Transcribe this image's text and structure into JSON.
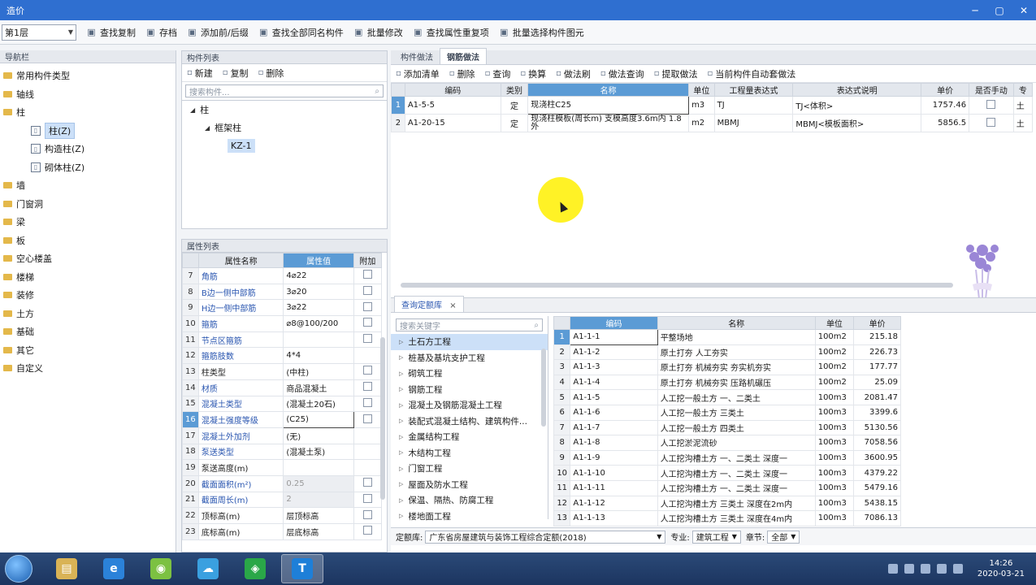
{
  "window": {
    "title": "造价",
    "controls": [
      "─",
      "▢",
      "✕"
    ]
  },
  "toolbar": {
    "floor_value": "第1层",
    "buttons": [
      {
        "label": "查找复制",
        "icon": "copy-icon"
      },
      {
        "label": "存档",
        "icon": "save-icon"
      },
      {
        "label": "添加前/后缀",
        "icon": "prefix-icon"
      },
      {
        "label": "查找全部同名构件",
        "icon": "find-icon"
      },
      {
        "label": "批量修改",
        "icon": "batch-edit-icon"
      },
      {
        "label": "查找属性重复项",
        "icon": "search-icon"
      },
      {
        "label": "批量选择构件图元",
        "icon": "select-icon"
      }
    ]
  },
  "nav": {
    "header": "导航栏",
    "items": [
      {
        "label": "常用构件类型",
        "child": false
      },
      {
        "label": "轴线",
        "child": false
      },
      {
        "label": "柱",
        "child": false
      },
      {
        "label": "柱(Z)",
        "child": true,
        "selected": true,
        "icon": "column-icon"
      },
      {
        "label": "构造柱(Z)",
        "child": true,
        "icon": "constructional-column-icon"
      },
      {
        "label": "砌体柱(Z)",
        "child": true,
        "icon": "masonry-column-icon"
      },
      {
        "label": "墙",
        "child": false
      },
      {
        "label": "门窗洞",
        "child": false
      },
      {
        "label": "梁",
        "child": false
      },
      {
        "label": "板",
        "child": false
      },
      {
        "label": "空心楼盖",
        "child": false
      },
      {
        "label": "楼梯",
        "child": false
      },
      {
        "label": "装修",
        "child": false
      },
      {
        "label": "土方",
        "child": false
      },
      {
        "label": "基础",
        "child": false
      },
      {
        "label": "其它",
        "child": false
      },
      {
        "label": "自定义",
        "child": false
      }
    ]
  },
  "component_list": {
    "header": "构件列表",
    "buttons": [
      {
        "label": "新建",
        "icon": "new-icon"
      },
      {
        "label": "复制",
        "icon": "copy-icon"
      },
      {
        "label": "删除",
        "icon": "delete-icon"
      }
    ],
    "search_placeholder": "搜索构件...",
    "tree": {
      "root": "柱",
      "group": "框架柱",
      "leaf": "KZ-1"
    }
  },
  "properties": {
    "header": "属性列表",
    "columns": [
      "属性名称",
      "属性值",
      "附加"
    ],
    "rows": [
      {
        "no": "7",
        "name": "角筋",
        "value": "4⌀22",
        "check": true
      },
      {
        "no": "8",
        "name": "B边一侧中部筋",
        "value": "3⌀20",
        "check": true
      },
      {
        "no": "9",
        "name": "H边一侧中部筋",
        "value": "3⌀22",
        "check": true
      },
      {
        "no": "10",
        "name": "箍筋",
        "value": "⌀8@100/200",
        "check": true
      },
      {
        "no": "11",
        "name": "节点区箍筋",
        "value": "",
        "check": true
      },
      {
        "no": "12",
        "name": "箍筋肢数",
        "value": "4*4",
        "check": false
      },
      {
        "no": "13",
        "name": "柱类型",
        "value": "(中柱)",
        "check": true,
        "black": true
      },
      {
        "no": "14",
        "name": "材质",
        "value": "商品混凝土",
        "check": true
      },
      {
        "no": "15",
        "name": "混凝土类型",
        "value": "(混凝土20石)",
        "check": true
      },
      {
        "no": "16",
        "name": "混凝土强度等级",
        "value": "(C25)",
        "check": true,
        "editing": true
      },
      {
        "no": "17",
        "name": "混凝土外加剂",
        "value": "(无)",
        "check": false
      },
      {
        "no": "18",
        "name": "泵送类型",
        "value": "(混凝土泵)",
        "check": false
      },
      {
        "no": "19",
        "name": "泵送高度(m)",
        "value": "",
        "check": false,
        "black": true
      },
      {
        "no": "20",
        "name": "截面面积(m²)",
        "value": "0.25",
        "check": true,
        "gray": true
      },
      {
        "no": "21",
        "name": "截面周长(m)",
        "value": "2",
        "check": true,
        "gray": true
      },
      {
        "no": "22",
        "name": "顶标高(m)",
        "value": "层顶标高",
        "check": true,
        "black": true
      },
      {
        "no": "23",
        "name": "底标高(m)",
        "value": "层底标高",
        "check": true,
        "black": true
      }
    ]
  },
  "main": {
    "tabs": [
      "构件做法",
      "钢筋做法"
    ],
    "active_tab": "钢筋做法",
    "toolbar": [
      {
        "label": "添加清单",
        "icon": "add-list-icon"
      },
      {
        "label": "删除",
        "icon": "delete-icon"
      },
      {
        "label": "查询",
        "icon": "query-icon"
      },
      {
        "label": "换算",
        "icon": "convert-icon"
      },
      {
        "label": "做法刷",
        "icon": "brush-icon"
      },
      {
        "label": "做法查询",
        "icon": "method-query-icon"
      },
      {
        "label": "提取做法",
        "icon": "extract-icon"
      },
      {
        "label": "当前构件自动套做法",
        "icon": "auto-apply-icon"
      }
    ],
    "columns": [
      "编码",
      "类别",
      "名称",
      "单位",
      "工程量表达式",
      "表达式说明",
      "单价",
      "是否手动",
      "专"
    ],
    "rows": [
      {
        "no": "1",
        "code": "A1-5-5",
        "type": "定",
        "name": "现浇柱C25",
        "unit": "m3",
        "expr": "TJ",
        "desc": "TJ<体积>",
        "price": "1757.46",
        "spec": "土",
        "selected": true
      },
      {
        "no": "2",
        "code": "A1-20-15",
        "type": "定",
        "name": "现浇柱模板(周长m) 支模高度3.6m内 1.8外",
        "unit": "m2",
        "expr": "MBMJ",
        "desc": "MBMJ<模板面积>",
        "price": "5856.5",
        "spec": "土"
      }
    ]
  },
  "library": {
    "tab": "查询定额库",
    "close": "×",
    "search_placeholder": "搜索关键字",
    "categories": [
      {
        "label": "土石方工程",
        "sel": true
      },
      {
        "label": "桩基及基坑支护工程"
      },
      {
        "label": "砌筑工程"
      },
      {
        "label": "钢筋工程"
      },
      {
        "label": "混凝土及钢筋混凝土工程"
      },
      {
        "label": "装配式混凝土结构、建筑构件..."
      },
      {
        "label": "金属结构工程"
      },
      {
        "label": "木结构工程"
      },
      {
        "label": "门窗工程"
      },
      {
        "label": "屋面及防水工程"
      },
      {
        "label": "保温、隔热、防腐工程"
      },
      {
        "label": "楼地面工程"
      }
    ],
    "columns": [
      "编码",
      "名称",
      "单位",
      "单价"
    ],
    "rows": [
      {
        "no": "1",
        "code": "A1-1-1",
        "name": "平整场地",
        "unit": "100m2",
        "price": "215.18",
        "sel": true
      },
      {
        "no": "2",
        "code": "A1-1-2",
        "name": "原土打夯 人工夯实",
        "unit": "100m2",
        "price": "226.73"
      },
      {
        "no": "3",
        "code": "A1-1-3",
        "name": "原土打夯 机械夯实 夯实机夯实",
        "unit": "100m2",
        "price": "177.77"
      },
      {
        "no": "4",
        "code": "A1-1-4",
        "name": "原土打夯 机械夯实 压路机碾压",
        "unit": "100m2",
        "price": "25.09"
      },
      {
        "no": "5",
        "code": "A1-1-5",
        "name": "人工挖一般土方 一、二类土",
        "unit": "100m3",
        "price": "2081.47"
      },
      {
        "no": "6",
        "code": "A1-1-6",
        "name": "人工挖一般土方 三类土",
        "unit": "100m3",
        "price": "3399.6"
      },
      {
        "no": "7",
        "code": "A1-1-7",
        "name": "人工挖一般土方 四类土",
        "unit": "100m3",
        "price": "5130.56"
      },
      {
        "no": "8",
        "code": "A1-1-8",
        "name": "人工挖淤泥流砂",
        "unit": "100m3",
        "price": "7058.56"
      },
      {
        "no": "9",
        "code": "A1-1-9",
        "name": "人工挖沟槽土方 一、二类土 深度一",
        "unit": "100m3",
        "price": "3600.95"
      },
      {
        "no": "10",
        "code": "A1-1-10",
        "name": "人工挖沟槽土方 一、二类土 深度一",
        "unit": "100m3",
        "price": "4379.22"
      },
      {
        "no": "11",
        "code": "A1-1-11",
        "name": "人工挖沟槽土方 一、二类土 深度一",
        "unit": "100m3",
        "price": "5479.16"
      },
      {
        "no": "12",
        "code": "A1-1-12",
        "name": "人工挖沟槽土方 三类土 深度在2m内",
        "unit": "100m3",
        "price": "5438.15"
      },
      {
        "no": "13",
        "code": "A1-1-13",
        "name": "人工挖沟槽土方 三类土 深度在4m内",
        "unit": "100m3",
        "price": "7086.13"
      }
    ],
    "quota_label": "定额库:",
    "quota_value": "广东省房屋建筑与装饰工程综合定额(2018)",
    "major_label": "专业:",
    "major_value": "建筑工程",
    "chapter_label": "章节:",
    "chapter_value": "全部"
  },
  "taskbar": {
    "apps": [
      {
        "name": "file-explorer",
        "color": "#d9b356",
        "glyph": "▤"
      },
      {
        "name": "internet-explorer",
        "color": "#2b82d9",
        "glyph": "e"
      },
      {
        "name": "browser",
        "color": "#7cc142",
        "glyph": "◉"
      },
      {
        "name": "cloud",
        "color": "#3aa0e0",
        "glyph": "☁"
      },
      {
        "name": "chat",
        "color": "#2aa748",
        "glyph": "◈"
      },
      {
        "name": "estimate-app",
        "color": "#1e7fd8",
        "glyph": "T",
        "active": true
      }
    ],
    "time": "14:26",
    "date": "2020-03-21"
  }
}
